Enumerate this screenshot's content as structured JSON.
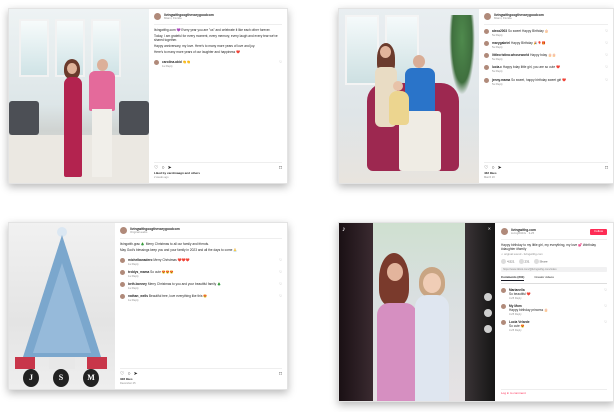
{
  "posts": [
    {
      "username": "livingwithgoogthevarygoodcom",
      "location": "Miami, Florida",
      "caption": [
        "livingwithg.com 💜 Every year you are \"us\" and celebrate it like each other forever.",
        "Today, I am grateful for every moment, every memory, every laugh and every tear we've shared together.",
        "Happy anniversary, my love. Here's to many more years of love and joy.",
        "Here's to many more years of our laughter and happiness ❤️"
      ],
      "comment": {
        "user": "carolina.abid",
        "text": "👏👏",
        "meta": "1w  Reply"
      },
      "likes": "Liked by carolinaagn and others",
      "date": "2 weeks ago"
    },
    {
      "username": "livingwithgoogthevarygoodcom",
      "location": "Miami, Florida",
      "comments": [
        {
          "user": "alexa2003",
          "text": "So sweet Happy Birthday 🎂",
          "meta": "5w  Reply"
        },
        {
          "user": "marygabriel",
          "text": "Happy Birthday 🎉🎈🎁",
          "meta": "5w  Reply"
        },
        {
          "user": "littlecristina.whoseworld",
          "text": "Happy bday 🎂🎂",
          "meta": "5w  Reply"
        },
        {
          "user": "lucia.c",
          "text": "Happy bday little girl, you are so cute ❤️",
          "meta": "5w  Reply"
        },
        {
          "user": "jenny.mama",
          "text": "So sweet, happy birthday sweet girl ❤️",
          "meta": "5w  Reply"
        }
      ],
      "likes": "432 likes",
      "date": "March 20"
    },
    {
      "username": "livingwithgoogthevarygoodcom",
      "location": "Original audio",
      "caption": [
        "livingwith.grac 🎄 Merry Christmas to all our family and friends.",
        "May God's blessings keep you and your family in 2023 and all the days to come 🙏"
      ],
      "comments": [
        {
          "user": "michelbanadero",
          "text": "Merry Christmas ❤️❤️❤️",
          "meta": "1w  Reply"
        },
        {
          "user": "teddys_mama",
          "text": "So cute 😍😍😍",
          "meta": "1w  Reply"
        },
        {
          "user": "beth.bonney",
          "text": "Merry Christmas to you and your beautiful family 🎄",
          "meta": "1w  Reply"
        },
        {
          "user": "nathan_wells",
          "text": "Beautiful tree, love everything like this 😍",
          "meta": "1w  Reply"
        }
      ],
      "likes": "328 likes",
      "date": "December 25"
    },
    {
      "tiktok": {
        "username": "livingwithg.com",
        "subline": "LivingWithG · 3-25",
        "follow": "Follow",
        "caption": "Happy birthday to my little girl, my everything, my love 💕 #birthday #daughter #family",
        "music": "♫ original sound - livingwithg.com",
        "actions": [
          "4,521",
          "231",
          "Share"
        ],
        "link": "https://www.tiktok.com/@livingwithg.com/video",
        "tabs": [
          "Comments (231)",
          "Creator videos"
        ],
        "comments": [
          {
            "user": "Marianella",
            "text": "So beautiful ❤️",
            "meta": "3-25  Reply"
          },
          {
            "user": "My Mom",
            "text": "Happy birthday princess 🎂",
            "meta": "3-25  Reply"
          },
          {
            "user": "Lucia Velarde",
            "text": "So cute 😍",
            "meta": "3-25  Reply"
          }
        ],
        "add_comment": "Log in to comment"
      }
    }
  ],
  "icons": {
    "heart": "♡",
    "comment": "○",
    "share": "➤",
    "save": "□",
    "tiktok_logo": "♪",
    "close": "✕"
  },
  "tree_letters": [
    "J",
    "S",
    "M"
  ],
  "colors": {
    "dress": "#b3234f",
    "shirt_pink": "#e46a9b",
    "shirt_blue": "#2a74c9",
    "chair": "#9d2850",
    "tree": "#7ba7cd",
    "tiktok_red": "#fe2c55"
  }
}
